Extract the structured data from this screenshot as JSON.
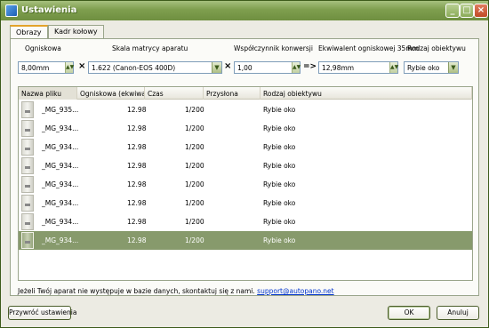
{
  "window": {
    "title": "Ustawienia"
  },
  "tabs": [
    {
      "label": "Obrazy"
    },
    {
      "label": "Kadr kołowy"
    }
  ],
  "controls": {
    "focal_label": "Ogniskowa",
    "focal_value": "8,00mm",
    "sensor_label": "Skala matrycy aparatu",
    "sensor_value": "1.622 (Canon-EOS 400D)",
    "conversion_label": "Współczynnik konwersji",
    "conversion_value": "1,00",
    "equiv_label": "Ekwiwalent ogniskowej 35mm",
    "equiv_value": "12,98mm",
    "lens_label": "Rodzaj obiektywu",
    "lens_value": "Rybie oko",
    "op_times_1": "×",
    "op_times_2": "×",
    "op_arrow": "=>"
  },
  "table": {
    "columns": [
      "Nazwa pliku",
      "Ogniskowa (ekwiwalent",
      "Czas",
      "Przysłona",
      "Rodzaj obiektywu"
    ],
    "rows": [
      {
        "file": "_MG_935...",
        "focal": "12.98",
        "time": "1/200",
        "aperture": "",
        "lens": "Rybie oko"
      },
      {
        "file": "_MG_934...",
        "focal": "12.98",
        "time": "1/200",
        "aperture": "",
        "lens": "Rybie oko"
      },
      {
        "file": "_MG_934...",
        "focal": "12.98",
        "time": "1/200",
        "aperture": "",
        "lens": "Rybie oko"
      },
      {
        "file": "_MG_934...",
        "focal": "12.98",
        "time": "1/200",
        "aperture": "",
        "lens": "Rybie oko"
      },
      {
        "file": "_MG_934...",
        "focal": "12.98",
        "time": "1/200",
        "aperture": "",
        "lens": "Rybie oko"
      },
      {
        "file": "_MG_934...",
        "focal": "12.98",
        "time": "1/200",
        "aperture": "",
        "lens": "Rybie oko"
      },
      {
        "file": "_MG_934...",
        "focal": "12.98",
        "time": "1/200",
        "aperture": "",
        "lens": "Rybie oko"
      },
      {
        "file": "_MG_934...",
        "focal": "12.98",
        "time": "1/200",
        "aperture": "",
        "lens": "Rybie oko"
      }
    ],
    "selected_index": 7
  },
  "note": {
    "text": "Jeżeli Twój aparat nie występuje w bazie danych, skontaktuj się z nami.",
    "link": "support@autopano.net"
  },
  "buttons": {
    "reset": "Przywróć ustawienia",
    "ok": "OK",
    "cancel": "Anuluj"
  },
  "colors": {
    "titlebar": "#7e9e4e",
    "selection": "#879a6c",
    "tab_accent": "#e3a32a"
  }
}
